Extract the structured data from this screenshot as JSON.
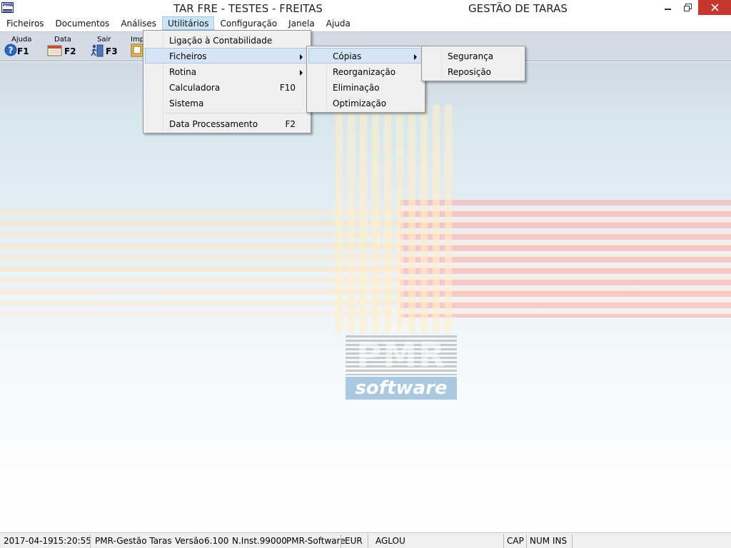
{
  "window": {
    "title_left": "TAR FRE - TESTES - FREITAS",
    "title_right": "GESTÃO DE TARAS",
    "app_icon_text": "PMR"
  },
  "menubar": [
    "Ficheiros",
    "Documentos",
    "Análises",
    "Utilitários",
    "Configuração",
    "Janela",
    "Ajuda"
  ],
  "toolbar": [
    {
      "label": "Ajuda",
      "key": "F1",
      "icon": "help-icon"
    },
    {
      "label": "Data",
      "key": "F2",
      "icon": "calendar-icon"
    },
    {
      "label": "Sair",
      "key": "F3",
      "icon": "exit-icon"
    },
    {
      "label": "Impr",
      "key": "",
      "icon": "print-icon"
    }
  ],
  "menu_utilitarios": {
    "items": [
      {
        "label": "Ligação à Contabilidade",
        "shortcut": "",
        "submenu": false
      },
      {
        "label": "Ficheiros",
        "shortcut": "",
        "submenu": true
      },
      {
        "label": "Rotina",
        "shortcut": "",
        "submenu": true
      },
      {
        "label": "Calculadora",
        "shortcut": "F10",
        "submenu": false
      },
      {
        "label": "Sistema",
        "shortcut": "",
        "submenu": false
      },
      {
        "label": "Data Processamento",
        "shortcut": "F2",
        "submenu": false
      }
    ]
  },
  "menu_ficheiros": {
    "items": [
      {
        "label": "Cópias",
        "submenu": true
      },
      {
        "label": "Reorganização",
        "submenu": false
      },
      {
        "label": "Eliminação",
        "submenu": false
      },
      {
        "label": "Optimização",
        "submenu": false
      }
    ]
  },
  "menu_copias": {
    "items": [
      {
        "label": "Segurança"
      },
      {
        "label": "Reposição"
      }
    ]
  },
  "logo": {
    "main": "PMR",
    "sub": "software"
  },
  "statusbar": {
    "date": "2017-04-19",
    "time": "15:20:55",
    "app": "PMR-Gestão Taras",
    "version_label": "Versão",
    "version": "6.100",
    "inst": "N.Inst.99000",
    "vendor": "PMR-Software",
    "currency": "EUR",
    "user": "AGLOU",
    "cap": "CAP",
    "num_ins": "NUM INS"
  }
}
